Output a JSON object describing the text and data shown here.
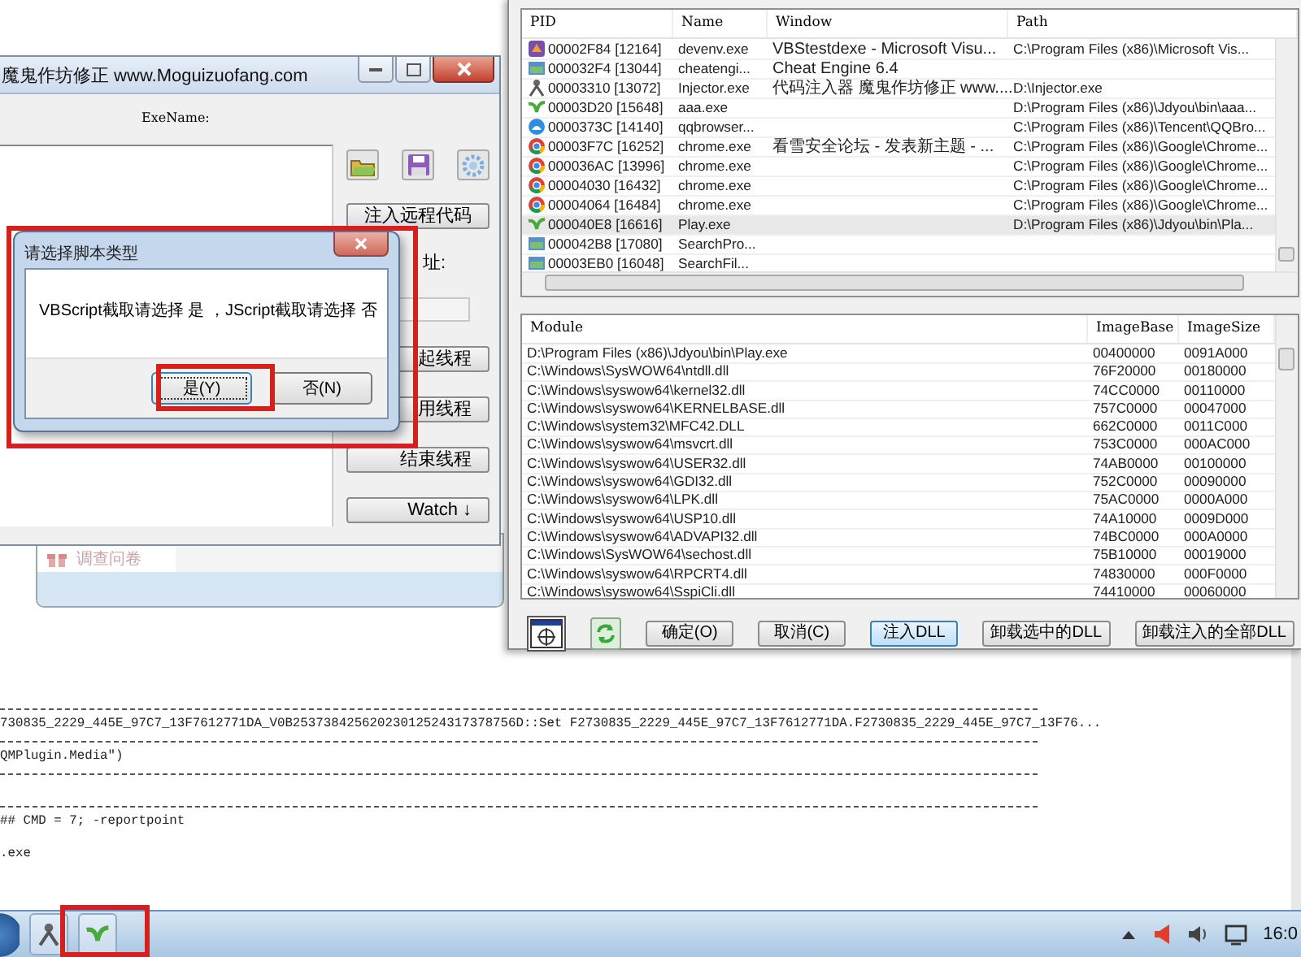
{
  "console": {
    "lines": [
      {
        "kind": "rule"
      },
      {
        "kind": "text",
        "text": "730835_2229_445E_97C7_13F7612771DA_V0B25373842562023012524317378756D::Set F2730835_2229_445E_97C7_13F7612771DA.F2730835_2229_445E_97C7_13F76..."
      },
      {
        "kind": "rule"
      },
      {
        "kind": "text",
        "text": "QMPlugin.Media\")"
      },
      {
        "kind": "rule"
      },
      {
        "kind": "blank"
      },
      {
        "kind": "rule"
      },
      {
        "kind": "text",
        "text": "## CMD = 7; -reportpoint"
      },
      {
        "kind": "blank"
      },
      {
        "kind": "text",
        "text": ".exe"
      }
    ]
  },
  "injector_window": {
    "title": "魔鬼作坊修正 www.Moguizuofang.com",
    "exe_label": "ExeName:",
    "controls": [
      {
        "kind": "button",
        "label": "注入远程代码"
      },
      {
        "kind": "label",
        "label": "址:"
      },
      {
        "kind": "field"
      },
      {
        "kind": "button",
        "label": "起线程"
      },
      {
        "kind": "button",
        "label": "用线程"
      },
      {
        "kind": "button",
        "label": "结束线程"
      },
      {
        "kind": "button",
        "label": "Watch ↓"
      }
    ]
  },
  "dialog": {
    "title": "请选择脚本类型",
    "message": "VBScript截取请选择 是 ，JScript截取请选择 否",
    "buttons": [
      {
        "label": "是(Y)",
        "focused": true
      },
      {
        "label": "否(N)",
        "focused": false
      }
    ]
  },
  "survey_panel": {
    "label": "调查问卷"
  },
  "process_window": {
    "process_list": {
      "columns": [
        "PID",
        "Name",
        "Window",
        "Path"
      ],
      "rows": [
        {
          "kind": "studio",
          "pid": "00002F84 [12164]",
          "name": "devenv.exe",
          "window": "VBStestdexe - Microsoft Visu...",
          "path": "C:\\Program Files (x86)\\Microsoft Vis...",
          "selected": false
        },
        {
          "kind": "app",
          "pid": "000032F4 [13044]",
          "name": "cheatengi...",
          "window": "Cheat Engine 6.4",
          "selected": false
        },
        {
          "kind": "figure",
          "pid": "00003310 [13072]",
          "name": "Injector.exe",
          "window": "代码注入器 魔鬼作坊修正 www....",
          "path": "D:\\Injector.exe",
          "selected": false
        },
        {
          "kind": "sprout",
          "pid": "00003D20 [15648]",
          "name": "aaa.exe",
          "path": "D:\\Program Files (x86)\\Jdyou\\bin\\aaa...",
          "selected": false
        },
        {
          "kind": "browser",
          "pid": "0000373C [14140]",
          "name": "qqbrowser...",
          "path": "C:\\Program Files (x86)\\Tencent\\QQBro...",
          "selected": false
        },
        {
          "kind": "chrome",
          "pid": "00003F7C [16252]",
          "name": "chrome.exe",
          "window": "看雪安全论坛 - 发表新主题 - ...",
          "path": "C:\\Program Files (x86)\\Google\\Chrome...",
          "selected": false
        },
        {
          "kind": "chrome",
          "pid": "000036AC [13996]",
          "name": "chrome.exe",
          "path": "C:\\Program Files (x86)\\Google\\Chrome...",
          "selected": false
        },
        {
          "kind": "chrome",
          "pid": "00004030 [16432]",
          "name": "chrome.exe",
          "path": "C:\\Program Files (x86)\\Google\\Chrome...",
          "selected": false
        },
        {
          "kind": "chrome",
          "pid": "00004064 [16484]",
          "name": "chrome.exe",
          "path": "C:\\Program Files (x86)\\Google\\Chrome...",
          "selected": false
        },
        {
          "kind": "sprout",
          "pid": "000040E8 [16616]",
          "name": "Play.exe",
          "path": "D:\\Program Files (x86)\\Jdyou\\bin\\Pla...",
          "selected": true
        },
        {
          "kind": "app",
          "pid": "000042B8 [17080]",
          "name": "SearchPro...",
          "selected": false
        },
        {
          "kind": "app",
          "pid": "00003EB0 [16048]",
          "name": "SearchFil...",
          "selected": false
        }
      ]
    },
    "module_list": {
      "columns": [
        "Module",
        "ImageBase",
        "ImageSize"
      ],
      "rows": [
        {
          "module": "D:\\Program Files (x86)\\Jdyou\\bin\\Play.exe",
          "image_base": "00400000",
          "image_size": "0091A000"
        },
        {
          "module": "C:\\Windows\\SysWOW64\\ntdll.dll",
          "image_base": "76F20000",
          "image_size": "00180000"
        },
        {
          "module": "C:\\Windows\\syswow64\\kernel32.dll",
          "image_base": "74CC0000",
          "image_size": "00110000"
        },
        {
          "module": "C:\\Windows\\syswow64\\KERNELBASE.dll",
          "image_base": "757C0000",
          "image_size": "00047000"
        },
        {
          "module": "C:\\Windows\\system32\\MFC42.DLL",
          "image_base": "662C0000",
          "image_size": "0011C000"
        },
        {
          "module": "C:\\Windows\\syswow64\\msvcrt.dll",
          "image_base": "753C0000",
          "image_size": "000AC000"
        },
        {
          "module": "C:\\Windows\\syswow64\\USER32.dll",
          "image_base": "74AB0000",
          "image_size": "00100000"
        },
        {
          "module": "C:\\Windows\\syswow64\\GDI32.dll",
          "image_base": "752C0000",
          "image_size": "00090000"
        },
        {
          "module": "C:\\Windows\\syswow64\\LPK.dll",
          "image_base": "75AC0000",
          "image_size": "0000A000"
        },
        {
          "module": "C:\\Windows\\syswow64\\USP10.dll",
          "image_base": "74A10000",
          "image_size": "0009D000"
        },
        {
          "module": "C:\\Windows\\syswow64\\ADVAPI32.dll",
          "image_base": "74BC0000",
          "image_size": "000A0000"
        },
        {
          "module": "C:\\Windows\\SysWOW64\\sechost.dll",
          "image_base": "75B10000",
          "image_size": "00019000"
        },
        {
          "module": "C:\\Windows\\syswow64\\RPCRT4.dll",
          "image_base": "74830000",
          "image_size": "000F0000"
        },
        {
          "module": "C:\\Windows\\syswow64\\SspiCli.dll",
          "image_base": "74410000",
          "image_size": "00060000"
        }
      ]
    },
    "buttons": [
      {
        "label": "确定(O)",
        "default": false
      },
      {
        "label": "取消(C)",
        "default": false
      },
      {
        "label": "注入DLL",
        "default": true
      },
      {
        "label": "卸载选中的DLL",
        "default": false
      },
      {
        "label": "卸载注入的全部DLL",
        "default": false
      }
    ]
  },
  "taskbar": {
    "items": [
      {
        "kind": "figure"
      },
      {
        "kind": "sprout"
      }
    ],
    "clock": "16:0"
  }
}
